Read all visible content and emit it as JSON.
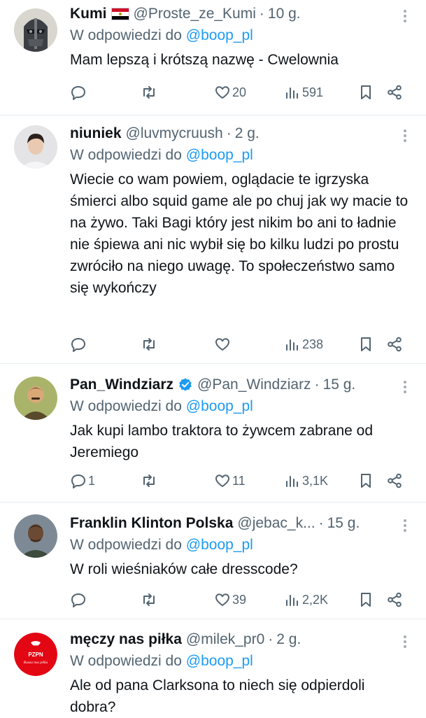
{
  "tweets": [
    {
      "name": "Kumi",
      "flag": "egypt-flag",
      "handle": "@Proste_ze_Kumi",
      "dot": "·",
      "time": "10 g.",
      "reply_prefix": "W odpowiedzi do",
      "reply_mention": "@boop_pl",
      "text": "Mam lepszą i krótszą nazwę - Cwelownia",
      "replies": "",
      "likes": "20",
      "views": "591",
      "avatar": "knight-helmet-avatar"
    },
    {
      "name": "niuniek",
      "handle": "@luvmycruush",
      "dot": "·",
      "time": "2 g.",
      "reply_prefix": "W odpowiedzi do",
      "reply_mention": "@boop_pl",
      "text": "Wiecie co wam powiem, oglądacie te igrzyska śmierci albo squid game ale po chuj jak wy macie to na żywo. Taki Bagi który jest nikim bo ani to ładnie nie śpiewa ani nic wybił się bo kilku ludzi po prostu zwróciło na niego uwagę. To społeczeństwo samo się wykończy",
      "replies": "",
      "likes": "",
      "views": "238",
      "avatar": "person-photo-avatar"
    },
    {
      "name": "Pan_Windziarz",
      "verified": true,
      "handle": "@Pan_Windziarz",
      "dot": "·",
      "time": "15 g.",
      "reply_prefix": "W odpowiedzi do",
      "reply_mention": "@boop_pl",
      "text": "Jak kupi lambo traktora to żywcem zabrane od Jeremiego",
      "replies": "1",
      "likes": "11",
      "views": "3,1K",
      "avatar": "cartoon-man-avatar"
    },
    {
      "name": "Franklin Klinton Polska",
      "handle": "@jebac_k...",
      "dot": "·",
      "time": "15 g.",
      "reply_prefix": "W odpowiedzi do",
      "reply_mention": "@boop_pl",
      "text": "W roli wieśniaków całe dresscode?",
      "replies": "",
      "likes": "39",
      "views": "2,2K",
      "avatar": "game-character-avatar"
    },
    {
      "name": "męczy nas piłka",
      "handle": "@milek_pr0",
      "dot": "·",
      "time": "2 g.",
      "reply_prefix": "W odpowiedzi do",
      "reply_mention": "@boop_pl",
      "text": "Ale od pana Clarksona to niech się odpierdoli dobra?",
      "avatar": "pzpn-logo-avatar",
      "avatar_logo_text": [
        "PZPN",
        "Rusza nas piłka"
      ]
    }
  ],
  "colors": {
    "accent": "#1d9bf0",
    "secondary_text": "#536471",
    "primary_text": "#0f1419",
    "divider": "#e6ecf0",
    "pzpn_red": "#e30613"
  }
}
